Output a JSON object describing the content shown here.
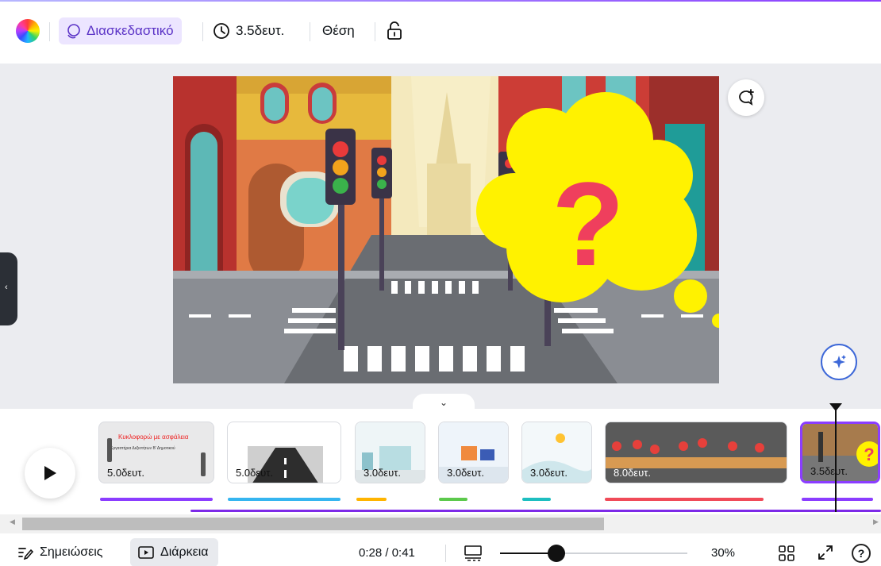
{
  "toolbar": {
    "animation_label": "Διασκεδαστικό",
    "duration_label": "3.5δευτ.",
    "position_label": "Θέση"
  },
  "canvas": {
    "bubble_text": "?"
  },
  "timeline": {
    "thumbnails": [
      {
        "duration": "5.0δευτ.",
        "title": "Κυκλοφορώ με ασφάλεια",
        "subtitle": "Εργαστήρια Δεξιοτήτων Β' Δημοτικού",
        "bar_color": "#8b3dff"
      },
      {
        "duration": "5.0δευτ.",
        "bar_color": "#35b5f0"
      },
      {
        "duration": "3.0δευτ.",
        "bar_color": "#ffb400"
      },
      {
        "duration": "3.0δευτ.",
        "bar_color": "#5cc94c"
      },
      {
        "duration": "3.0δευτ.",
        "bar_color": "#1dbec0"
      },
      {
        "duration": "8.0δευτ.",
        "bar_color": "#f04a58"
      },
      {
        "duration": "3.5δευτ.",
        "bar_color": "#8b3dff"
      }
    ]
  },
  "bottombar": {
    "notes_label": "Σημειώσεις",
    "duration_label": "Διάρκεια",
    "time_readout": "0:28 / 0:41",
    "zoom_readout": "30%",
    "zoom_level": 0.3
  },
  "colors": {
    "accent": "#8b3dff",
    "selected_tab_bg": "#ece5ff"
  }
}
